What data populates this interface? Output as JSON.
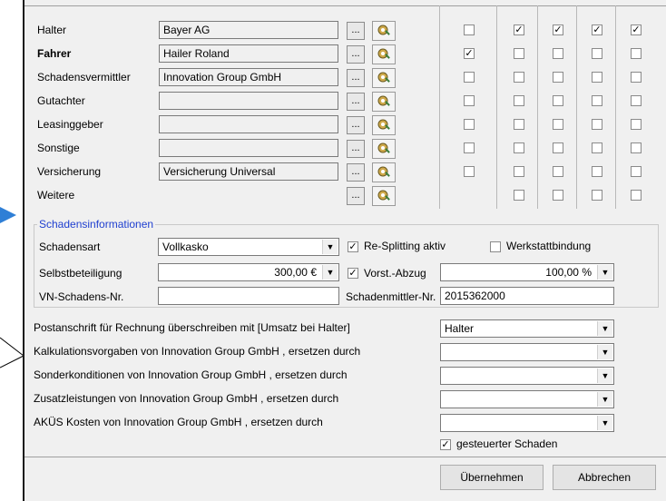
{
  "parties": [
    {
      "label": "Halter",
      "value": "Bayer AG",
      "bold": false,
      "disabled": false,
      "checks": [
        false,
        true,
        true,
        true,
        true
      ],
      "dot": "...",
      "first_cb": true
    },
    {
      "label": "Fahrer",
      "value": "Hailer Roland",
      "bold": true,
      "disabled": false,
      "checks": [
        true,
        false,
        false,
        false,
        false
      ],
      "dot": "...",
      "first_cb": true
    },
    {
      "label": "Schadensvermittler",
      "value": "Innovation Group GmbH",
      "bold": false,
      "disabled": false,
      "checks": [
        false,
        false,
        false,
        false,
        false
      ],
      "dot": "...",
      "first_cb": true
    },
    {
      "label": "Gutachter",
      "value": "",
      "bold": false,
      "disabled": true,
      "checks": [
        false,
        false,
        false,
        false,
        false
      ],
      "dot": "...",
      "first_cb": true
    },
    {
      "label": "Leasinggeber",
      "value": "",
      "bold": false,
      "disabled": true,
      "checks": [
        false,
        false,
        false,
        false,
        false
      ],
      "dot": "...",
      "first_cb": true
    },
    {
      "label": "Sonstige",
      "value": "",
      "bold": false,
      "disabled": true,
      "checks": [
        false,
        false,
        false,
        false,
        false
      ],
      "dot": "...",
      "first_cb": true
    },
    {
      "label": "Versicherung",
      "value": "Versicherung Universal",
      "bold": false,
      "disabled": false,
      "checks": [
        false,
        false,
        false,
        false,
        false
      ],
      "dot": "...",
      "first_cb": true
    },
    {
      "label": "Weitere",
      "value": null,
      "bold": false,
      "disabled": false,
      "checks": [
        false,
        false,
        false,
        false,
        false
      ],
      "dot": "...",
      "first_cb": false
    }
  ],
  "check_mark": "✓",
  "schaden": {
    "group_title": "Schadensinformationen",
    "schadensart_label": "Schadensart",
    "schadensart_value": "Vollkasko",
    "resplitting_label": "Re-Splitting aktiv",
    "resplitting_checked": true,
    "werkstatt_label": "Werkstattbindung",
    "werkstatt_checked": false,
    "selbst_label": "Selbstbeteiligung",
    "selbst_value": "300,00 €",
    "vorst_label": "Vorst.-Abzug",
    "vorst_checked": true,
    "vorst_value": "100,00 %",
    "vn_label": "VN-Schadens-Nr.",
    "vn_value": "",
    "vermittler_nr_label": "Schadenmittler-Nr.",
    "vermittler_nr_value": "2015362000"
  },
  "overrides": [
    {
      "label": "Postanschrift für Rechnung überschreiben mit  [Umsatz bei Halter]",
      "value": "Halter"
    },
    {
      "label": "Kalkulationsvorgaben von Innovation Group GmbH , ersetzen durch",
      "value": ""
    },
    {
      "label": "Sonderkonditionen von Innovation Group GmbH , ersetzen durch",
      "value": ""
    },
    {
      "label": "Zusatzleistungen von Innovation Group GmbH , ersetzen durch",
      "value": ""
    },
    {
      "label": "AKÜS Kosten von Innovation Group GmbH , ersetzen durch",
      "value": ""
    }
  ],
  "gesteuert_label": "gesteuerter Schaden",
  "gesteuert_checked": true,
  "buttons": {
    "ok": "Übernehmen",
    "cancel": "Abbrechen"
  },
  "colors": {
    "group_title": "#1f3fd0",
    "pointer": "#2f7fd6"
  }
}
